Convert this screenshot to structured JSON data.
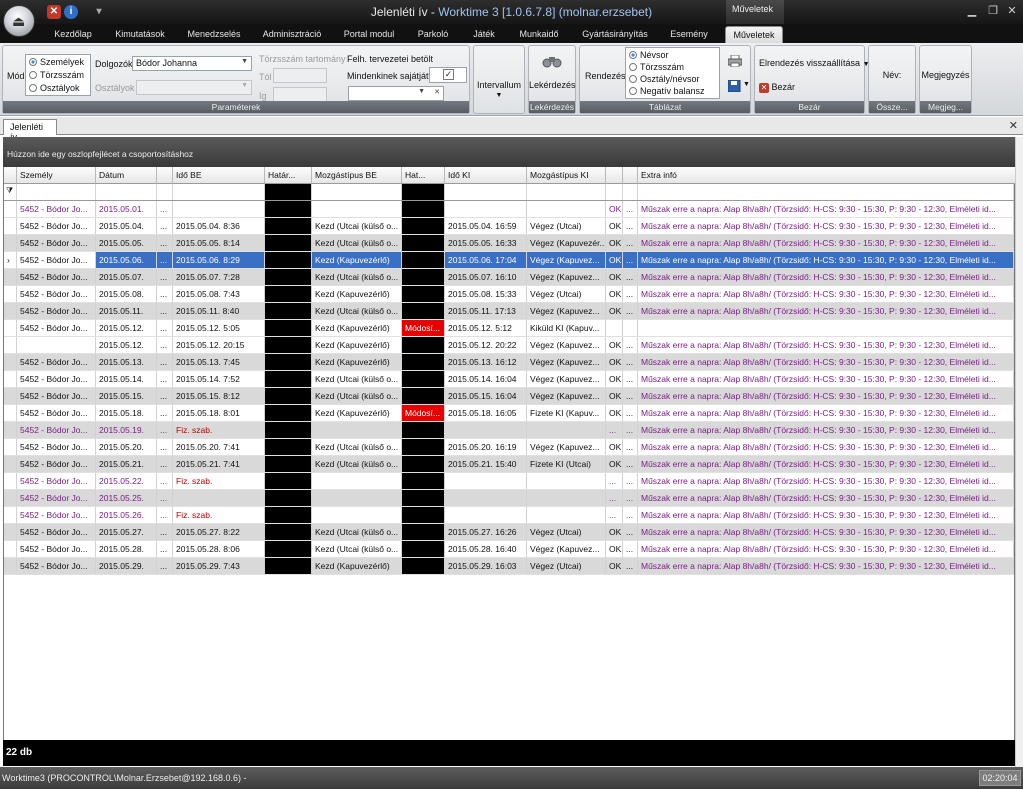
{
  "app": {
    "title_prefix": "Jelenléti ív - ",
    "title_main": "Worktime 3 [1.0.6.7.8] (molnar.erzsebet)",
    "context_tab_header": "Műveletek"
  },
  "ribbon_tabs": [
    "Kezdőlap",
    "Kimutatások",
    "Menedzselés",
    "Adminisztráció",
    "Portal modul",
    "Parkoló",
    "Játék",
    "Munkaidő",
    "Gyártásirányítás",
    "Esemény",
    "Műveletek"
  ],
  "ribbon": {
    "mod_label": "Mód",
    "mod_options": [
      "Személyek",
      "Törzsszám",
      "Osztályok"
    ],
    "dolgozok_label": "Dolgozók",
    "dolgozok_value": "Bódor Johanna",
    "osztalyok_label": "Osztályok",
    "torzsszam_range_label": "Törzsszám tartomány",
    "tol_label": "Tól",
    "ig_label": "Ig",
    "felh_label": "Felh. tervezetei betölt",
    "mindenkinek_label": "Mindenkinek sajátját",
    "parameterek_caption": "Paraméterek",
    "intervallum_label": "Intervallum",
    "lekerdezes_label": "Lekérdezés",
    "lekerdezes_caption": "Lekérdezés",
    "rendezes_label": "Rendezés",
    "sort_options": [
      "Névsor",
      "Törzsszám",
      "Osztály/névsor",
      "Negatív balansz"
    ],
    "tablazat_caption": "Táblázat",
    "elrendezes_label": "Elrendezés visszaállítása",
    "bezar_label": "Bezár",
    "bezar_caption": "Bezár",
    "nev_label": "Név:",
    "osszes_caption": "Össze...",
    "megjegyzes_label": "Megjegyzés",
    "megjegyzes_caption": "Megjeg..."
  },
  "doc_tab": "Jelenléti ív",
  "group_panel_text": "Húzzon ide egy oszlopfejlécet a csoportosításhoz",
  "columns": [
    "Személy",
    "Dátum",
    "",
    "Idő BE",
    "Határ...",
    "Mozgástípus BE",
    "Hat...",
    "Idő KI",
    "Mozgástípus KI",
    "",
    "",
    "Extra infó"
  ],
  "rows": [
    {
      "szemely": "5452 - Bódor Jo...",
      "datum": "2015.05.01.",
      "c2": "...",
      "ido_be": "",
      "mozg_be": "",
      "hat2": "",
      "ido_ki": "",
      "mozg_ki": "",
      "ok": "OK",
      "c10": "...",
      "extra": "Műszak erre a napra: Alap 8h/a8h/ (Törzsidő: H-CS: 9:30 - 15:30, P: 9:30 - 12:30, Elméleti id...",
      "style": "purple"
    },
    {
      "szemely": "5452 - Bódor Jo...",
      "datum": "2015.05.04.",
      "c2": "...",
      "ido_be": "2015.05.04. 8:36",
      "mozg_be": "Kezd (Utcai (külső o...",
      "hat2": "",
      "ido_ki": "2015.05.04. 16:59",
      "mozg_ki": "Végez (Utcai)",
      "ok": "OK",
      "c10": "...",
      "extra": "Műszak erre a napra: Alap 8h/a8h/ (Törzsidő: H-CS: 9:30 - 15:30, P: 9:30 - 12:30, Elméleti id...",
      "style": "white"
    },
    {
      "szemely": "5452 - Bódor Jo...",
      "datum": "2015.05.05.",
      "c2": "...",
      "ido_be": "2015.05.05. 8:14",
      "mozg_be": "Kezd (Utcai (külső o...",
      "hat2": "",
      "ido_ki": "2015.05.05. 16:33",
      "mozg_ki": "Végez (Kapuvezér...",
      "ok": "OK",
      "c10": "...",
      "extra": "Műszak erre a napra: Alap 8h/a8h/ (Törzsidő: H-CS: 9:30 - 15:30, P: 9:30 - 12:30, Elméleti id...",
      "style": "gray"
    },
    {
      "szemely": "5452 - Bódor Jo...",
      "datum": "2015.05.06.",
      "c2": "...",
      "ido_be": "2015.05.06. 8:29",
      "mozg_be": "Kezd (Kapuvezérlő)",
      "hat2": "",
      "ido_ki": "2015.05.06. 17:04",
      "mozg_ki": "Végez (Kapuvez...",
      "ok": "OK",
      "c10": "...",
      "extra": "Műszak erre a napra: Alap 8h/a8h/ (Törzsidő: H-CS: 9:30 - 15:30, P: 9:30 - 12:30, Elméleti id...",
      "style": "selected"
    },
    {
      "szemely": "5452 - Bódor Jo...",
      "datum": "2015.05.07.",
      "c2": "...",
      "ido_be": "2015.05.07. 7:28",
      "mozg_be": "Kezd (Utcai (külső o...",
      "hat2": "",
      "ido_ki": "2015.05.07. 16:10",
      "mozg_ki": "Végez (Kapuvez...",
      "ok": "OK",
      "c10": "...",
      "extra": "Műszak erre a napra: Alap 8h/a8h/ (Törzsidő: H-CS: 9:30 - 15:30, P: 9:30 - 12:30, Elméleti id...",
      "style": "gray"
    },
    {
      "szemely": "5452 - Bódor Jo...",
      "datum": "2015.05.08.",
      "c2": "...",
      "ido_be": "2015.05.08. 7:43",
      "mozg_be": "Kezd (Kapuvezérlő)",
      "hat2": "",
      "ido_ki": "2015.05.08. 15:33",
      "mozg_ki": "Végez (Utcai)",
      "ok": "OK",
      "c10": "...",
      "extra": "Műszak erre a napra: Alap 8h/a8h/ (Törzsidő: H-CS: 9:30 - 15:30, P: 9:30 - 12:30, Elméleti id...",
      "style": "white"
    },
    {
      "szemely": "5452 - Bódor Jo...",
      "datum": "2015.05.11.",
      "c2": "...",
      "ido_be": "2015.05.11. 8:40",
      "mozg_be": "Kezd (Utcai (külső o...",
      "hat2": "",
      "ido_ki": "2015.05.11. 17:13",
      "mozg_ki": "Végez (Kapuvez...",
      "ok": "OK",
      "c10": "...",
      "extra": "Műszak erre a napra: Alap 8h/a8h/ (Törzsidő: H-CS: 9:30 - 15:30, P: 9:30 - 12:30, Elméleti id...",
      "style": "gray"
    },
    {
      "szemely": "5452 - Bódor Jo...",
      "datum": "2015.05.12.",
      "c2": "...",
      "ido_be": "2015.05.12. 5:05",
      "mozg_be": "Kezd (Kapuvezérlő)",
      "hat2": "Módosí...",
      "ido_ki": "2015.05.12. 5:12",
      "mozg_ki": "Kiküld KI (Kapuv...",
      "ok": "",
      "c10": "",
      "extra": "",
      "style": "white"
    },
    {
      "szemely": "",
      "datum": "2015.05.12.",
      "c2": "...",
      "ido_be": "2015.05.12. 20:15",
      "mozg_be": "Kezd (Kapuvezérlő)",
      "hat2": "",
      "ido_ki": "2015.05.12. 20:22",
      "mozg_ki": "Végez (Kapuvez...",
      "ok": "OK",
      "c10": "...",
      "extra": "Műszak erre a napra: Alap 8h/a8h/ (Törzsidő: H-CS: 9:30 - 15:30, P: 9:30 - 12:30, Elméleti id...",
      "style": "white"
    },
    {
      "szemely": "5452 - Bódor Jo...",
      "datum": "2015.05.13.",
      "c2": "...",
      "ido_be": "2015.05.13. 7:45",
      "mozg_be": "Kezd (Kapuvezérlő)",
      "hat2": "",
      "ido_ki": "2015.05.13. 16:12",
      "mozg_ki": "Végez (Kapuvez...",
      "ok": "OK",
      "c10": "...",
      "extra": "Műszak erre a napra: Alap 8h/a8h/ (Törzsidő: H-CS: 9:30 - 15:30, P: 9:30 - 12:30, Elméleti id...",
      "style": "gray"
    },
    {
      "szemely": "5452 - Bódor Jo...",
      "datum": "2015.05.14.",
      "c2": "...",
      "ido_be": "2015.05.14. 7:52",
      "mozg_be": "Kezd (Utcai (külső o...",
      "hat2": "",
      "ido_ki": "2015.05.14. 16:04",
      "mozg_ki": "Végez (Kapuvez...",
      "ok": "OK",
      "c10": "...",
      "extra": "Műszak erre a napra: Alap 8h/a8h/ (Törzsidő: H-CS: 9:30 - 15:30, P: 9:30 - 12:30, Elméleti id...",
      "style": "white"
    },
    {
      "szemely": "5452 - Bódor Jo...",
      "datum": "2015.05.15.",
      "c2": "...",
      "ido_be": "2015.05.15. 8:12",
      "mozg_be": "Kezd (Utcai (külső o...",
      "hat2": "",
      "ido_ki": "2015.05.15. 16:04",
      "mozg_ki": "Végez (Kapuvez...",
      "ok": "OK",
      "c10": "...",
      "extra": "Műszak erre a napra: Alap 8h/a8h/ (Törzsidő: H-CS: 9:30 - 15:30, P: 9:30 - 12:30, Elméleti id...",
      "style": "gray"
    },
    {
      "szemely": "5452 - Bódor Jo...",
      "datum": "2015.05.18.",
      "c2": "...",
      "ido_be": "2015.05.18. 8:01",
      "mozg_be": "Kezd (Kapuvezérlő)",
      "hat2": "Módosí...",
      "ido_ki": "2015.05.18. 16:05",
      "mozg_ki": "Fizete KI (Kapuv...",
      "ok": "OK",
      "c10": "...",
      "extra": "Műszak erre a napra: Alap 8h/a8h/ (Törzsidő: H-CS: 9:30 - 15:30, P: 9:30 - 12:30, Elméleti id...",
      "style": "white"
    },
    {
      "szemely": "5452 - Bódor Jo...",
      "datum": "2015.05.19.",
      "c2": "...",
      "ido_be": "Fiz. szab.",
      "mozg_be": "",
      "hat2": "",
      "ido_ki": "",
      "mozg_ki": "",
      "ok": "...",
      "c10": "...",
      "extra": "Műszak erre a napra: Alap 8h/a8h/ (Törzsidő: H-CS: 9:30 - 15:30, P: 9:30 - 12:30, Elméleti id...",
      "style": "purplegray"
    },
    {
      "szemely": "5452 - Bódor Jo...",
      "datum": "2015.05.20.",
      "c2": "...",
      "ido_be": "2015.05.20. 7:41",
      "mozg_be": "Kezd (Utcai (külső o...",
      "hat2": "",
      "ido_ki": "2015.05.20. 16:19",
      "mozg_ki": "Végez (Kapuvez...",
      "ok": "OK",
      "c10": "...",
      "extra": "Műszak erre a napra: Alap 8h/a8h/ (Törzsidő: H-CS: 9:30 - 15:30, P: 9:30 - 12:30, Elméleti id...",
      "style": "white"
    },
    {
      "szemely": "5452 - Bódor Jo...",
      "datum": "2015.05.21.",
      "c2": "...",
      "ido_be": "2015.05.21. 7:41",
      "mozg_be": "Kezd (Utcai (külső o...",
      "hat2": "",
      "ido_ki": "2015.05.21. 15:40",
      "mozg_ki": "Fizete KI (Utcai)",
      "ok": "OK",
      "c10": "...",
      "extra": "Műszak erre a napra: Alap 8h/a8h/ (Törzsidő: H-CS: 9:30 - 15:30, P: 9:30 - 12:30, Elméleti id...",
      "style": "gray"
    },
    {
      "szemely": "5452 - Bódor Jo...",
      "datum": "2015.05.22.",
      "c2": "...",
      "ido_be": "Fiz. szab.",
      "mozg_be": "",
      "hat2": "",
      "ido_ki": "",
      "mozg_ki": "",
      "ok": "...",
      "c10": "...",
      "extra": "Műszak erre a napra: Alap 8h/a8h/ (Törzsidő: H-CS: 9:30 - 15:30, P: 9:30 - 12:30, Elméleti id...",
      "style": "purple"
    },
    {
      "szemely": "5452 - Bódor Jo...",
      "datum": "2015.05.25.",
      "c2": "...",
      "ido_be": "",
      "mozg_be": "",
      "hat2": "",
      "ido_ki": "",
      "mozg_ki": "",
      "ok": "...",
      "c10": "...",
      "extra": "Műszak erre a napra: Alap 8h/a8h/ (Törzsidő: H-CS: 9:30 - 15:30, P: 9:30 - 12:30, Elméleti id...",
      "style": "purplegray"
    },
    {
      "szemely": "5452 - Bódor Jo...",
      "datum": "2015.05.26.",
      "c2": "...",
      "ido_be": "Fiz. szab.",
      "mozg_be": "",
      "hat2": "",
      "ido_ki": "",
      "mozg_ki": "",
      "ok": "...",
      "c10": "...",
      "extra": "Műszak erre a napra: Alap 8h/a8h/ (Törzsidő: H-CS: 9:30 - 15:30, P: 9:30 - 12:30, Elméleti id...",
      "style": "purple"
    },
    {
      "szemely": "5452 - Bódor Jo...",
      "datum": "2015.05.27.",
      "c2": "...",
      "ido_be": "2015.05.27. 8:22",
      "mozg_be": "Kezd (Utcai (külső o...",
      "hat2": "",
      "ido_ki": "2015.05.27. 16:26",
      "mozg_ki": "Végez (Utcai)",
      "ok": "OK",
      "c10": "...",
      "extra": "Műszak erre a napra: Alap 8h/a8h/ (Törzsidő: H-CS: 9:30 - 15:30, P: 9:30 - 12:30, Elméleti id...",
      "style": "gray"
    },
    {
      "szemely": "5452 - Bódor Jo...",
      "datum": "2015.05.28.",
      "c2": "...",
      "ido_be": "2015.05.28. 8:06",
      "mozg_be": "Kezd (Utcai (külső o...",
      "hat2": "",
      "ido_ki": "2015.05.28. 16:40",
      "mozg_ki": "Végez (Kapuvez...",
      "ok": "OK",
      "c10": "...",
      "extra": "Műszak erre a napra: Alap 8h/a8h/ (Törzsidő: H-CS: 9:30 - 15:30, P: 9:30 - 12:30, Elméleti id...",
      "style": "white"
    },
    {
      "szemely": "5452 - Bódor Jo...",
      "datum": "2015.05.29.",
      "c2": "...",
      "ido_be": "2015.05.29. 7:43",
      "mozg_be": "Kezd (Kapuvezérlő)",
      "hat2": "",
      "ido_ki": "2015.05.29. 16:03",
      "mozg_ki": "Végez (Utcai)",
      "ok": "OK",
      "c10": "...",
      "extra": "Műszak erre a napra: Alap 8h/a8h/ (Törzsidő: H-CS: 9:30 - 15:30, P: 9:30 - 12:30, Elméleti id...",
      "style": "gray"
    }
  ],
  "footer_count": "22 db",
  "status": {
    "text": "Worktime3 (PROCONTROL\\Molnar.Erzsebet@192.168.0.6)  -",
    "time": "02:20:04"
  },
  "colors": {
    "selected_row": "#3a6fc6",
    "alt_row": "#d9d9d9",
    "purple_text": "#7a1f86",
    "red_text": "#c00000",
    "modify_flag": "#e60000"
  }
}
